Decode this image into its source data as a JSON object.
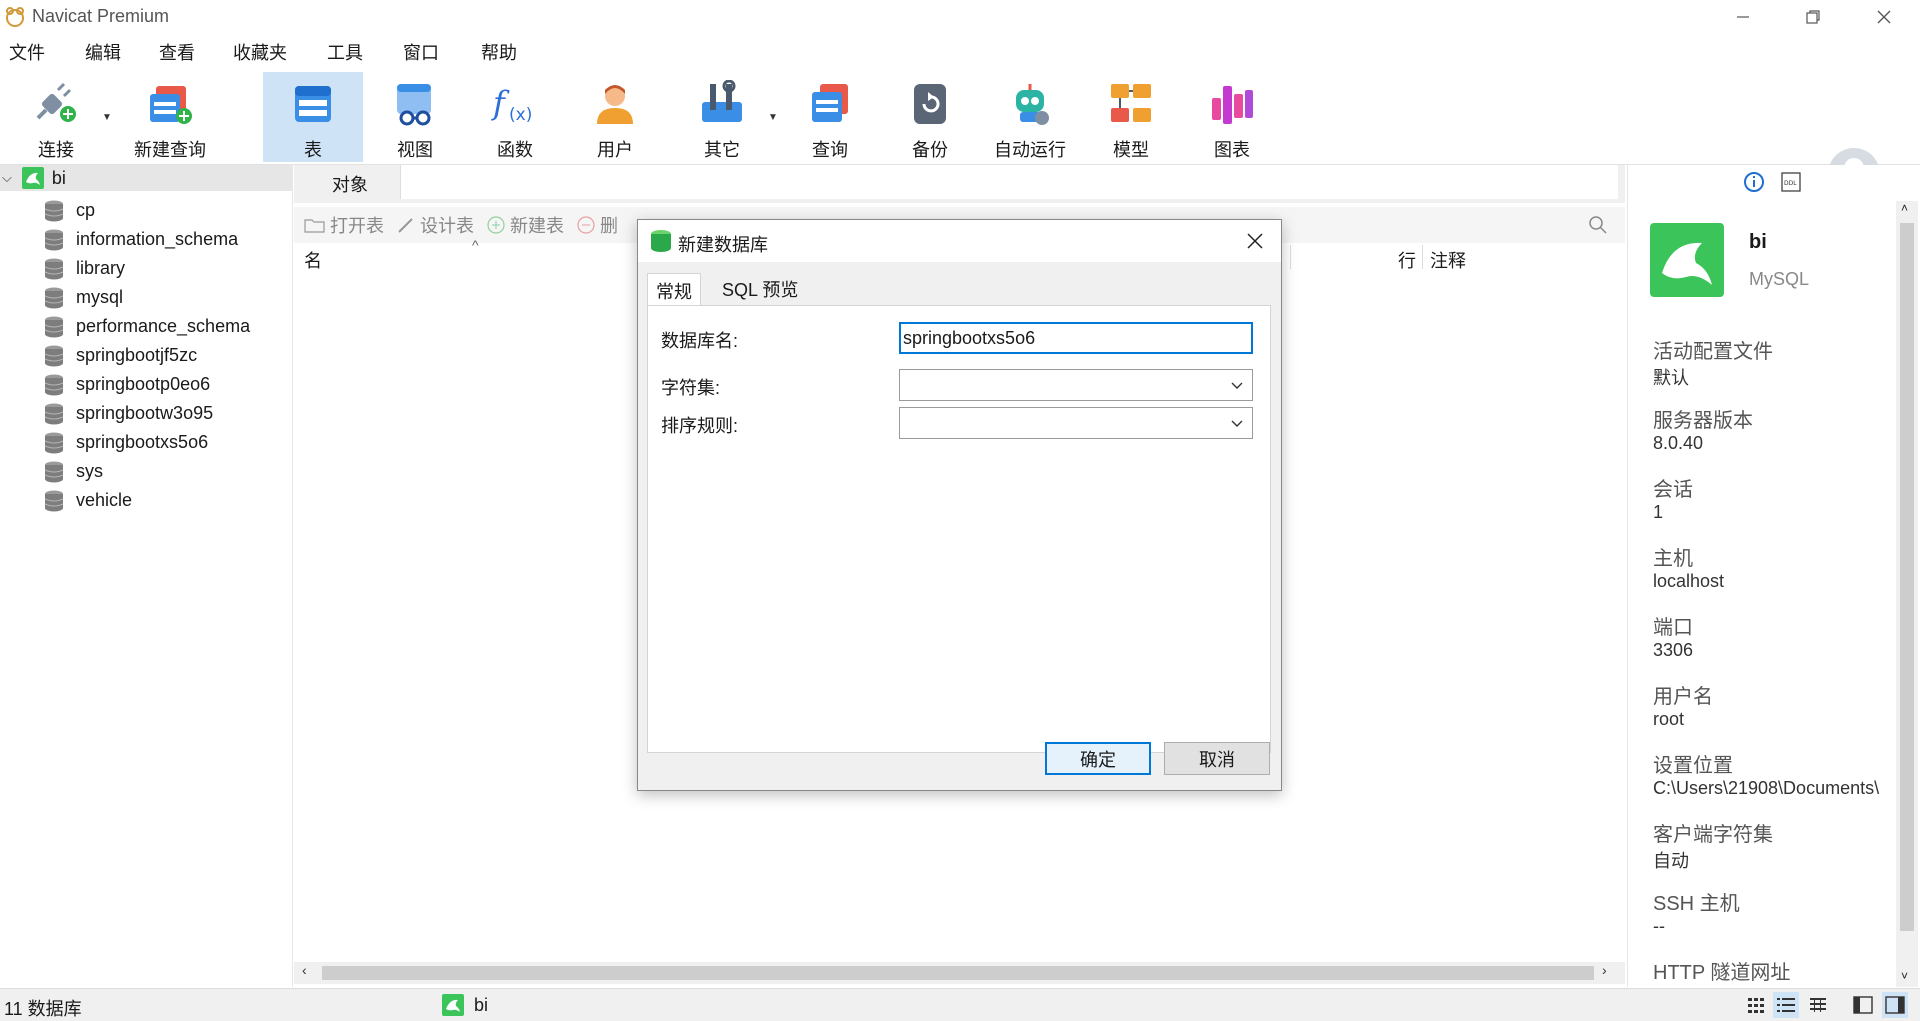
{
  "app": {
    "title": "Navicat Premium"
  },
  "menu": [
    "文件",
    "编辑",
    "查看",
    "收藏夹",
    "工具",
    "窗口",
    "帮助"
  ],
  "toolbar": {
    "connect": "连接",
    "new_query": "新建查询",
    "table": "表",
    "view": "视图",
    "function": "函数",
    "user": "用户",
    "other": "其它",
    "query": "查询",
    "backup": "备份",
    "auto_run": "自动运行",
    "model": "模型",
    "chart": "图表"
  },
  "tree": {
    "connection": "bi",
    "databases": [
      "cp",
      "information_schema",
      "library",
      "mysql",
      "performance_schema",
      "springbootjf5zc",
      "springbootp0eo6",
      "springbootw3o95",
      "springbootxs5o6",
      "sys",
      "vehicle"
    ]
  },
  "center": {
    "tab": "对象",
    "actions": {
      "open": "打开表",
      "design": "设计表",
      "new": "新建表",
      "delete": "删"
    },
    "columns": {
      "name": "名",
      "rows": "行",
      "comment": "注释"
    }
  },
  "dialog": {
    "title": "新建数据库",
    "tabs": [
      "常规",
      "SQL 预览"
    ],
    "db_name_label": "数据库名:",
    "db_name_value": "springbootxs5o6",
    "charset_label": "字符集:",
    "collation_label": "排序规则:",
    "ok": "确定",
    "cancel": "取消"
  },
  "info": {
    "name": "bi",
    "type": "MySQL",
    "fields": [
      {
        "k": "活动配置文件",
        "v": "默认"
      },
      {
        "k": "服务器版本",
        "v": "8.0.40"
      },
      {
        "k": "会话",
        "v": "1"
      },
      {
        "k": "主机",
        "v": "localhost"
      },
      {
        "k": "端口",
        "v": "3306"
      },
      {
        "k": "用户名",
        "v": "root"
      },
      {
        "k": "设置位置",
        "v": "C:\\Users\\21908\\Documents\\"
      },
      {
        "k": "客户端字符集",
        "v": "自动"
      },
      {
        "k": "SSH 主机",
        "v": "--"
      },
      {
        "k": "HTTP 隧道网址",
        "v": ""
      }
    ]
  },
  "status": {
    "count": "11 数据库",
    "connection": "bi"
  },
  "colors": {
    "accent": "#0078d7",
    "mysql_green": "#3bc45a",
    "selected_tool": "#cfe3f7"
  }
}
